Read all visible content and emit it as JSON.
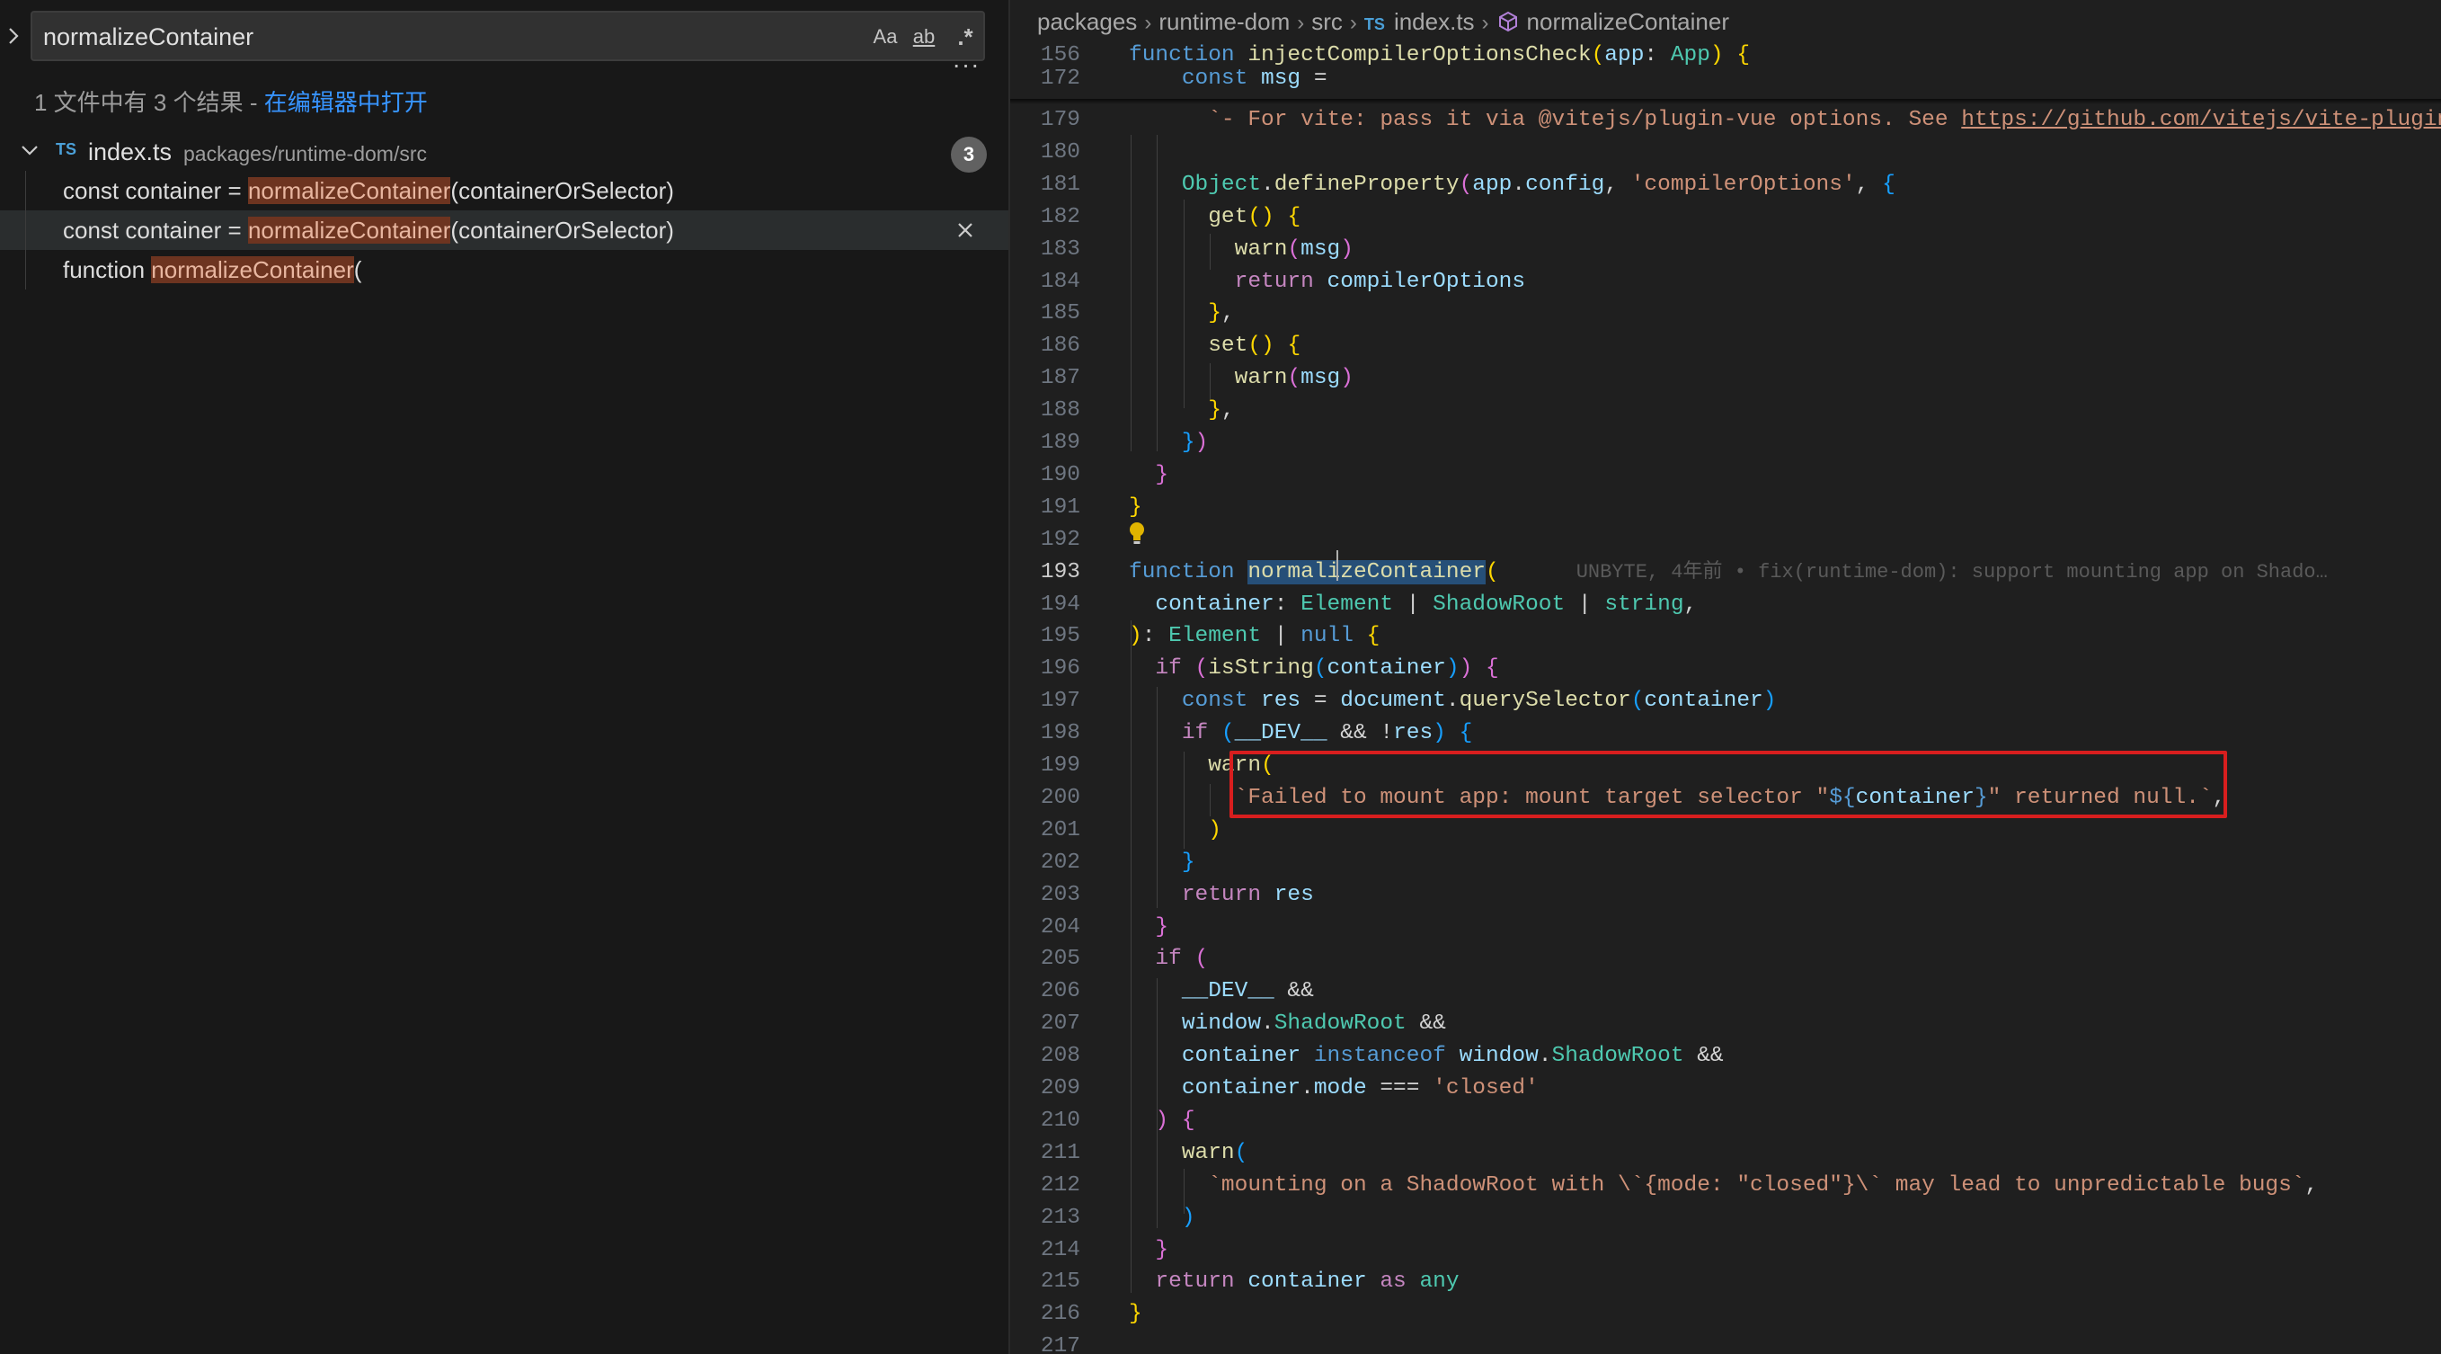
{
  "search": {
    "query": "normalizeContainer",
    "toggle_icon": "chevron-right-icon",
    "options": {
      "match_case": "Aa",
      "whole_word": "ab",
      "regex": ".*"
    },
    "more_icon": "ellipsis-icon",
    "summary": "1 文件中有 3 个结果 - ",
    "open_in_editor": "在编辑器中打开"
  },
  "results": {
    "file": {
      "lang_badge": "TS",
      "name": "index.ts",
      "path": "packages/runtime-dom/src",
      "count": "3"
    },
    "matches": [
      {
        "before": "const container = ",
        "match": "normalizeContainer",
        "after": "(containerOrSelector)",
        "selected": false
      },
      {
        "before": "const container = ",
        "match": "normalizeContainer",
        "after": "(containerOrSelector)",
        "selected": true
      },
      {
        "before": "function ",
        "match": "normalizeContainer",
        "after": "(",
        "selected": false
      }
    ]
  },
  "breadcrumb": {
    "items": [
      "packages",
      "runtime-dom",
      "src"
    ],
    "file_badge": "TS",
    "file": "index.ts",
    "symbol": "normalizeContainer"
  },
  "editor": {
    "active_line": "193",
    "blame": "UNBYTE, 4年前 • fix(runtime-dom): support mounting app on Shado…",
    "lines": [
      {
        "n": "156",
        "t": [
          [
            "kw",
            "function "
          ],
          [
            "fn",
            "injectCompilerOptionsCheck"
          ],
          [
            "pn",
            "("
          ],
          [
            "var",
            "app"
          ],
          [
            "op",
            ": "
          ],
          [
            "ty",
            "App"
          ],
          [
            "pn",
            ")"
          ],
          [
            "op",
            " "
          ],
          [
            "pn",
            "{"
          ]
        ]
      },
      {
        "n": "172",
        "t": [
          [
            "op",
            "    "
          ],
          [
            "kw",
            "const "
          ],
          [
            "var",
            "msg"
          ],
          [
            "op",
            " ="
          ]
        ]
      },
      {
        "n": "179",
        "t": [
          [
            "op",
            "      "
          ],
          [
            "str",
            "`- For vite: pass it via @vitejs/plugin-vue options. See "
          ],
          [
            "lnk",
            "https://github.com/vitejs/vite-plugin-"
          ]
        ]
      },
      {
        "n": "180",
        "t": []
      },
      {
        "n": "181",
        "t": [
          [
            "op",
            "    "
          ],
          [
            "ty",
            "Object"
          ],
          [
            "op",
            "."
          ],
          [
            "fn",
            "defineProperty"
          ],
          [
            "pn2",
            "("
          ],
          [
            "var",
            "app"
          ],
          [
            "op",
            "."
          ],
          [
            "var",
            "config"
          ],
          [
            "op",
            ", "
          ],
          [
            "str",
            "'compilerOptions'"
          ],
          [
            "op",
            ", "
          ],
          [
            "pn3",
            "{"
          ]
        ]
      },
      {
        "n": "182",
        "t": [
          [
            "op",
            "      "
          ],
          [
            "fn",
            "get"
          ],
          [
            "pn",
            "()"
          ],
          [
            "op",
            " "
          ],
          [
            "pn",
            "{"
          ]
        ]
      },
      {
        "n": "183",
        "t": [
          [
            "op",
            "        "
          ],
          [
            "fn",
            "warn"
          ],
          [
            "pn2",
            "("
          ],
          [
            "var",
            "msg"
          ],
          [
            "pn2",
            ")"
          ]
        ]
      },
      {
        "n": "184",
        "t": [
          [
            "op",
            "        "
          ],
          [
            "kw2",
            "return "
          ],
          [
            "var",
            "compilerOptions"
          ]
        ]
      },
      {
        "n": "185",
        "t": [
          [
            "op",
            "      "
          ],
          [
            "pn",
            "}"
          ],
          [
            "op",
            ","
          ]
        ]
      },
      {
        "n": "186",
        "t": [
          [
            "op",
            "      "
          ],
          [
            "fn",
            "set"
          ],
          [
            "pn",
            "()"
          ],
          [
            "op",
            " "
          ],
          [
            "pn",
            "{"
          ]
        ]
      },
      {
        "n": "187",
        "t": [
          [
            "op",
            "        "
          ],
          [
            "fn",
            "warn"
          ],
          [
            "pn2",
            "("
          ],
          [
            "var",
            "msg"
          ],
          [
            "pn2",
            ")"
          ]
        ]
      },
      {
        "n": "188",
        "t": [
          [
            "op",
            "      "
          ],
          [
            "pn",
            "}"
          ],
          [
            "op",
            ","
          ]
        ]
      },
      {
        "n": "189",
        "t": [
          [
            "op",
            "    "
          ],
          [
            "pn3",
            "}"
          ],
          [
            "pn2",
            ")"
          ]
        ]
      },
      {
        "n": "190",
        "t": [
          [
            "op",
            "  "
          ],
          [
            "pn2",
            "}"
          ]
        ]
      },
      {
        "n": "191",
        "t": [
          [
            "pn",
            "}"
          ]
        ]
      },
      {
        "n": "192",
        "t": []
      },
      {
        "n": "193",
        "t": [
          [
            "kw",
            "function "
          ],
          [
            "fn sym-hl",
            "normalizeContainer"
          ],
          [
            "pn",
            "("
          ]
        ],
        "blame": true
      },
      {
        "n": "194",
        "t": [
          [
            "op",
            "  "
          ],
          [
            "var",
            "container"
          ],
          [
            "op",
            ": "
          ],
          [
            "ty",
            "Element"
          ],
          [
            "op",
            " | "
          ],
          [
            "ty",
            "ShadowRoot"
          ],
          [
            "op",
            " | "
          ],
          [
            "ty",
            "string"
          ],
          [
            "op",
            ","
          ]
        ]
      },
      {
        "n": "195",
        "t": [
          [
            "pn",
            ")"
          ],
          [
            "op",
            ": "
          ],
          [
            "ty",
            "Element"
          ],
          [
            "op",
            " | "
          ],
          [
            "kw",
            "null"
          ],
          [
            "op",
            " "
          ],
          [
            "pn",
            "{"
          ]
        ]
      },
      {
        "n": "196",
        "t": [
          [
            "op",
            "  "
          ],
          [
            "kw2",
            "if"
          ],
          [
            "op",
            " "
          ],
          [
            "pn2",
            "("
          ],
          [
            "fn",
            "isString"
          ],
          [
            "pn3",
            "("
          ],
          [
            "var",
            "container"
          ],
          [
            "pn3",
            ")"
          ],
          [
            "pn2",
            ")"
          ],
          [
            "op",
            " "
          ],
          [
            "pn2",
            "{"
          ]
        ]
      },
      {
        "n": "197",
        "t": [
          [
            "op",
            "    "
          ],
          [
            "kw",
            "const "
          ],
          [
            "var",
            "res"
          ],
          [
            "op",
            " = "
          ],
          [
            "var",
            "document"
          ],
          [
            "op",
            "."
          ],
          [
            "fn",
            "querySelector"
          ],
          [
            "pn3",
            "("
          ],
          [
            "var",
            "container"
          ],
          [
            "pn3",
            ")"
          ]
        ]
      },
      {
        "n": "198",
        "t": [
          [
            "op",
            "    "
          ],
          [
            "kw2",
            "if"
          ],
          [
            "op",
            " "
          ],
          [
            "pn3",
            "("
          ],
          [
            "var",
            "__DEV__"
          ],
          [
            "op",
            " && !"
          ],
          [
            "var",
            "res"
          ],
          [
            "pn3",
            ")"
          ],
          [
            "op",
            " "
          ],
          [
            "pn3",
            "{"
          ]
        ]
      },
      {
        "n": "199",
        "t": [
          [
            "op",
            "      "
          ],
          [
            "fn",
            "warn"
          ],
          [
            "pn",
            "("
          ]
        ]
      },
      {
        "n": "200",
        "t": [
          [
            "op",
            "        "
          ],
          [
            "str",
            "`Failed to mount app: mount target selector \""
          ],
          [
            "kw",
            "${"
          ],
          [
            "var",
            "container"
          ],
          [
            "kw",
            "}"
          ],
          [
            "str",
            "\" returned null.`"
          ],
          [
            "op",
            ","
          ]
        ]
      },
      {
        "n": "201",
        "t": [
          [
            "op",
            "      "
          ],
          [
            "pn",
            ")"
          ]
        ]
      },
      {
        "n": "202",
        "t": [
          [
            "op",
            "    "
          ],
          [
            "pn3",
            "}"
          ]
        ]
      },
      {
        "n": "203",
        "t": [
          [
            "op",
            "    "
          ],
          [
            "kw2",
            "return "
          ],
          [
            "var",
            "res"
          ]
        ]
      },
      {
        "n": "204",
        "t": [
          [
            "op",
            "  "
          ],
          [
            "pn2",
            "}"
          ]
        ]
      },
      {
        "n": "205",
        "t": [
          [
            "op",
            "  "
          ],
          [
            "kw2",
            "if"
          ],
          [
            "op",
            " "
          ],
          [
            "pn2",
            "("
          ]
        ]
      },
      {
        "n": "206",
        "t": [
          [
            "op",
            "    "
          ],
          [
            "var",
            "__DEV__"
          ],
          [
            "op",
            " &&"
          ]
        ]
      },
      {
        "n": "207",
        "t": [
          [
            "op",
            "    "
          ],
          [
            "var",
            "window"
          ],
          [
            "op",
            "."
          ],
          [
            "ty",
            "ShadowRoot"
          ],
          [
            "op",
            " &&"
          ]
        ]
      },
      {
        "n": "208",
        "t": [
          [
            "op",
            "    "
          ],
          [
            "var",
            "container"
          ],
          [
            "op",
            " "
          ],
          [
            "kw",
            "instanceof"
          ],
          [
            "op",
            " "
          ],
          [
            "var",
            "window"
          ],
          [
            "op",
            "."
          ],
          [
            "ty",
            "ShadowRoot"
          ],
          [
            "op",
            " &&"
          ]
        ]
      },
      {
        "n": "209",
        "t": [
          [
            "op",
            "    "
          ],
          [
            "var",
            "container"
          ],
          [
            "op",
            "."
          ],
          [
            "var",
            "mode"
          ],
          [
            "op",
            " === "
          ],
          [
            "str",
            "'closed'"
          ]
        ]
      },
      {
        "n": "210",
        "t": [
          [
            "op",
            "  "
          ],
          [
            "pn2",
            ")"
          ],
          [
            "op",
            " "
          ],
          [
            "pn2",
            "{"
          ]
        ]
      },
      {
        "n": "211",
        "t": [
          [
            "op",
            "    "
          ],
          [
            "fn",
            "warn"
          ],
          [
            "pn3",
            "("
          ]
        ]
      },
      {
        "n": "212",
        "t": [
          [
            "op",
            "      "
          ],
          [
            "str",
            "`mounting on a ShadowRoot with \\`{mode: \"closed\"}\\` may lead to unpredictable bugs`"
          ],
          [
            "op",
            ","
          ]
        ]
      },
      {
        "n": "213",
        "t": [
          [
            "op",
            "    "
          ],
          [
            "pn3",
            ")"
          ]
        ]
      },
      {
        "n": "214",
        "t": [
          [
            "op",
            "  "
          ],
          [
            "pn2",
            "}"
          ]
        ]
      },
      {
        "n": "215",
        "t": [
          [
            "op",
            "  "
          ],
          [
            "kw2",
            "return "
          ],
          [
            "var",
            "container"
          ],
          [
            "op",
            " "
          ],
          [
            "kw2",
            "as"
          ],
          [
            "op",
            " "
          ],
          [
            "ty",
            "any"
          ]
        ]
      },
      {
        "n": "216",
        "t": [
          [
            "pn",
            "}"
          ]
        ]
      },
      {
        "n": "217",
        "t": []
      }
    ]
  },
  "colors": {
    "annotation": "#d81e1e",
    "match_highlight": "#6d3420",
    "link": "#3794ff"
  }
}
